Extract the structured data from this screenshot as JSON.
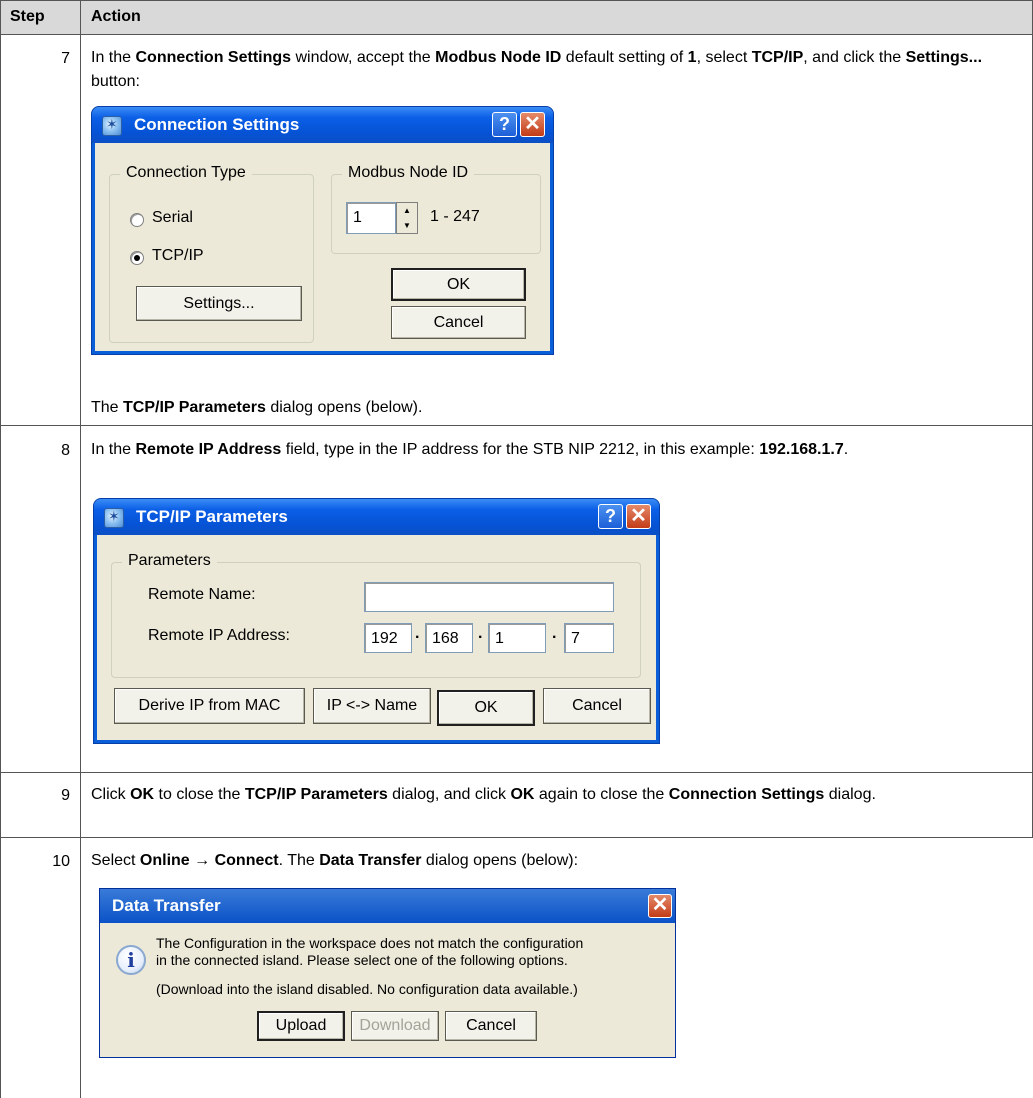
{
  "table": {
    "header": {
      "step": "Step",
      "action": "Action"
    },
    "rows": [
      {
        "step": "7",
        "text_before": "In the ",
        "t1": "Connection Settings",
        "t2": " window, accept the ",
        "t3": "Modbus Node ID",
        "t4": " default setting of ",
        "t5": "1",
        "t6": ", select ",
        "t7": "TCP/IP",
        "t8": ", and click the ",
        "t9": "Settings...",
        "t10": " button:",
        "after_a": "The ",
        "after_b": "TCP/IP Parameters",
        "after_c": " dialog opens (below)."
      },
      {
        "step": "8",
        "t1": "In the ",
        "t2": "Remote IP Address",
        "t3": " field, type in the IP address for the STB NIP 2212, in this example: ",
        "t4": "192.168.1.7",
        "t5": "."
      },
      {
        "step": "9",
        "t1": "Click ",
        "t2": "OK",
        "t3": " to close the ",
        "t4": "TCP/IP Parameters",
        "t5": " dialog, and click ",
        "t6": "OK",
        "t7": " again to close the ",
        "t8": "Connection Settings",
        "t9": " dialog."
      },
      {
        "step": "10",
        "t1": "Select ",
        "t2": "Online",
        "t3": " → ",
        "t4": "Connect",
        "t5": ". The ",
        "t6": "Data Transfer",
        "t7": " dialog opens (below):"
      }
    ]
  },
  "connection_dialog": {
    "title": "Connection Settings",
    "help": "?",
    "close": "✕",
    "conn_type_label": "Connection Type",
    "serial_label": "Serial",
    "tcpip_label": "TCP/IP",
    "selected": "TCP/IP",
    "settings_button": "Settings...",
    "node_id_label": "Modbus Node ID",
    "node_id_value": "1",
    "node_id_range": "1 - 247",
    "ok_button": "OK",
    "cancel_button": "Cancel"
  },
  "tcpip_dialog": {
    "title": "TCP/IP Parameters",
    "help": "?",
    "close": "✕",
    "group_label": "Parameters",
    "remote_name_label": "Remote Name:",
    "remote_name_value": "",
    "remote_ip_label": "Remote IP Address:",
    "ip": [
      "192",
      "168",
      "1",
      "7"
    ],
    "dot": ".",
    "derive_button": "Derive IP from MAC",
    "ipname_button": "IP <-> Name",
    "ok_button": "OK",
    "cancel_button": "Cancel"
  },
  "data_transfer_dialog": {
    "title": "Data Transfer",
    "close": "✕",
    "icon": "i",
    "message_line1": "The Configuration in the workspace does not match the configuration",
    "message_line2": "in the connected island. Please select one of the following options.",
    "message_line3": "(Download into the island disabled. No configuration data available.)",
    "upload_button": "Upload",
    "download_button": "Download",
    "cancel_button": "Cancel"
  }
}
